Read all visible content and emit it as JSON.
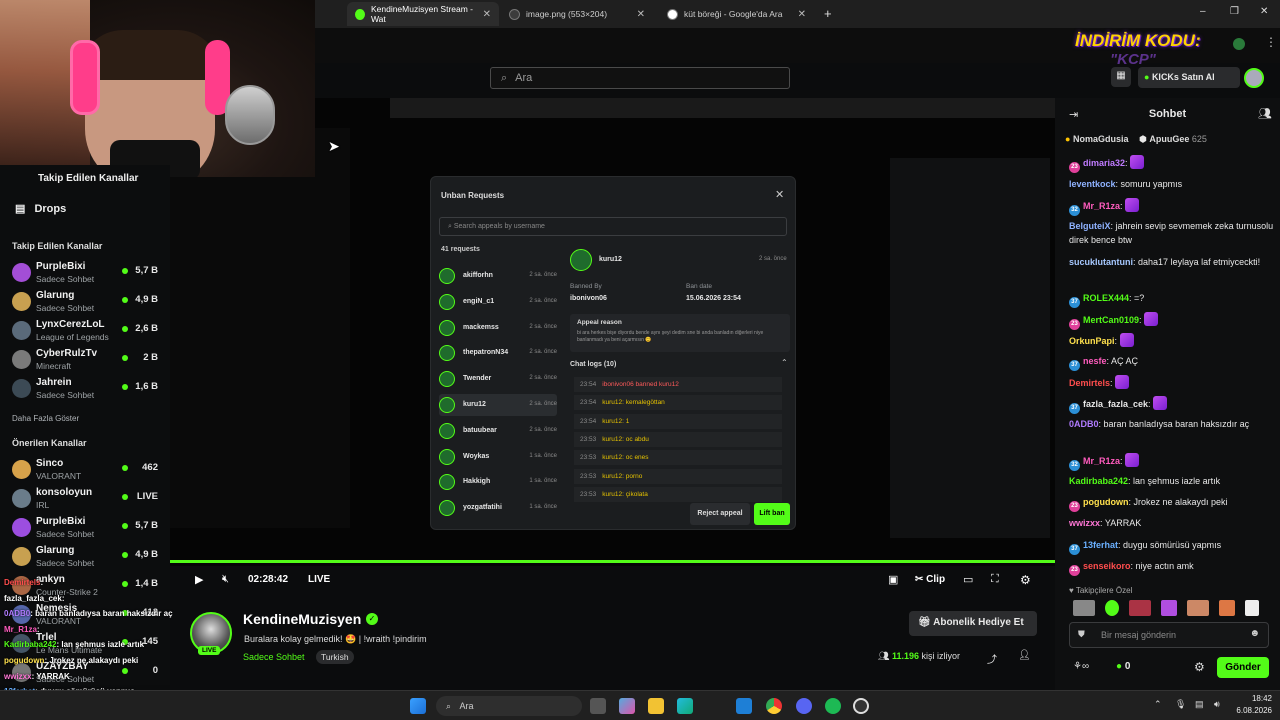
{
  "browser": {
    "tabs": [
      {
        "title": "KendineMuzisyen Stream - Wat",
        "active": true
      },
      {
        "title": "image.png (553×204)",
        "active": false
      },
      {
        "title": "küt böreği - Google'da Ara",
        "active": false
      }
    ],
    "new_tab": "+",
    "window_controls": [
      "–",
      "❐",
      "✕"
    ]
  },
  "header": {
    "search_placeholder": "Ara",
    "promo": "İNDİRİM KODU:",
    "promo_code": "\"KCP\"",
    "buy_kicks": "KICKs Satın Al"
  },
  "sidebar": {
    "top_cut": "Takip Edilen Kanallar",
    "drops": "Drops",
    "followed_title": "Takip Edilen Kanallar",
    "followed": [
      {
        "name": "PurpleBixi",
        "category": "Sadece Sohbet",
        "viewers": "5,7 B"
      },
      {
        "name": "Glarung",
        "category": "Sadece Sohbet",
        "viewers": "4,9 B"
      },
      {
        "name": "LynxCerezLoL",
        "category": "League of Legends",
        "viewers": "2,6 B"
      },
      {
        "name": "CyberRulzTv",
        "category": "Minecraft",
        "viewers": "2 B"
      },
      {
        "name": "Jahrein",
        "category": "Sadece Sohbet",
        "viewers": "1,6 B"
      }
    ],
    "show_more": "Daha Fazla Göster",
    "recommended_title": "Önerilen Kanallar",
    "recommended": [
      {
        "name": "Sinco",
        "category": "VALORANT",
        "viewers": "462"
      },
      {
        "name": "konsoloyun",
        "category": "IRL",
        "viewers": "LIVE"
      },
      {
        "name": "PurpleBixi",
        "category": "Sadece Sohbet",
        "viewers": "5,7 B"
      },
      {
        "name": "Glarung",
        "category": "Sadece Sohbet",
        "viewers": "4,9 B"
      },
      {
        "name": "ankyn",
        "category": "Counter-Strike 2",
        "viewers": "1,4 B"
      },
      {
        "name": "Nemesis",
        "category": "VALORANT",
        "viewers": "412"
      },
      {
        "name": "Trlel",
        "category": "Le Mans Ultimate",
        "viewers": "145"
      },
      {
        "name": "UZAYZBAY",
        "category": "Sadece Sohbet",
        "viewers": "0"
      }
    ]
  },
  "stream_overlay_chat": [
    {
      "user": "Demirtels",
      "text": "",
      "color": "#ff4d4d"
    },
    {
      "user": "fazla_fazla_cek",
      "text": "",
      "color": "#ffffff"
    },
    {
      "user": "0ADB0",
      "text": "baran banladıysa baran haksızdır aç",
      "color": "#b07bff"
    },
    {
      "user": "Mr_R1za",
      "text": "",
      "color": "#ff5cbe"
    },
    {
      "user": "Kadirbaba242",
      "text": "lan şehmus iazle artık",
      "color": "#53fc18"
    },
    {
      "user": "pogudown",
      "text": "Jrokez ne alakaydı peki",
      "color": "#ffe14d"
    },
    {
      "user": "wwizxx",
      "text": "YARRAK",
      "color": "#ff77d6"
    },
    {
      "user": "13ferhat",
      "text": "duygu sömürüsü yapmıs",
      "color": "#6ab0ff"
    },
    {
      "user": "senseikoro",
      "text": "niye actın amk",
      "color": "#ff4d4d"
    }
  ],
  "modal": {
    "title": "Unban Requests",
    "search_placeholder": "Search appeals by username",
    "count": "41 requests",
    "list": [
      {
        "name": "akifforhn",
        "time": "2 sa. önce"
      },
      {
        "name": "engiN_c1",
        "time": "2 sa. önce"
      },
      {
        "name": "mackemss",
        "time": "2 sa. önce"
      },
      {
        "name": "thepatronN34",
        "time": "2 sa. önce"
      },
      {
        "name": "Twender",
        "time": "2 sa. önce"
      },
      {
        "name": "kuru12",
        "time": "2 sa. önce"
      },
      {
        "name": "batuubear",
        "time": "2 sa. önce"
      },
      {
        "name": "Woykas",
        "time": "1 sa. önce"
      },
      {
        "name": "Hakkigh",
        "time": "1 sa. önce"
      },
      {
        "name": "yozgatfatihi",
        "time": "1 sa. önce"
      }
    ],
    "selected_user": "kuru12",
    "selected_time": "2 sa. önce",
    "banned_by_label": "Banned By",
    "banned_by": "ibonivon06",
    "ban_date_label": "Ban date",
    "ban_date": "15.06.2026 23:54",
    "appeal_label": "Appeal reason",
    "appeal_text": "bi ara herkes bişe diyordu bende aynı şeyi dedim sne bi anda banladın diğerleri niye banlanmadı ya beni açarmısın 😊",
    "chat_logs_label": "Chat logs (10)",
    "logs": [
      {
        "time": "23:54",
        "text": "ibonivon06 banned kuru12"
      },
      {
        "time": "23:54",
        "text": "kuru12: kemalegöttan"
      },
      {
        "time": "23:54",
        "text": "kuru12: 1"
      },
      {
        "time": "23:53",
        "text": "kuru12: oc abdu"
      },
      {
        "time": "23:53",
        "text": "kuru12: oc enes"
      },
      {
        "time": "23:53",
        "text": "kuru12: porno"
      },
      {
        "time": "23:53",
        "text": "kuru12: çikolata"
      }
    ],
    "reject": "Reject appeal",
    "lift": "Lift ban"
  },
  "player": {
    "time": "02:28:42",
    "live": "LIVE",
    "clip": "Clip"
  },
  "channel": {
    "name": "KendineMuzisyen",
    "title": "Buralara kolay gelmedik! 🤩 | !wraith !pindirim",
    "category": "Sadece Sohbet",
    "language": "Turkish",
    "live": "LIVE",
    "sub_gift": "Abonelik Hediye Et",
    "viewers": "11.196",
    "viewers_label": "kişi izliyor"
  },
  "chat": {
    "title": "Sohbet",
    "top_gifters": [
      {
        "name": "NomaGdusia",
        "count": ""
      },
      {
        "name": "ApuuGee",
        "count": "625"
      }
    ],
    "messages": [
      {
        "badge": "23",
        "badge_color": "#e0409a",
        "user": "dimaria32",
        "color": "#c07bff",
        "text": "",
        "emote": true
      },
      {
        "badge": "",
        "user": "leventkock",
        "color": "#8fb2ff",
        "text": "somuru yapmıs",
        "emote": false
      },
      {
        "badge": "32",
        "badge_color": "#2b8fd6",
        "user": "Mr_R1za",
        "color": "#ff5cbe",
        "text": "",
        "emote": true
      },
      {
        "badge": "",
        "user": "BelguteiX",
        "color": "#8fb2ff",
        "text": "jahrein sevip sevmemek zeka turnusolu direk bence btw",
        "emote": false
      },
      {
        "badge": "",
        "user": "sucukIutantuni",
        "color": "#a6c8ff",
        "text": "daha17 leylaya laf etmiyceckti!",
        "emote": false
      },
      {
        "badge": "37",
        "badge_color": "#2b8fd6",
        "user": "ROLEX444",
        "color": "#53fc18",
        "text": "=?",
        "emote": false
      },
      {
        "badge": "23",
        "badge_color": "#e0409a",
        "user": "MertCan0109",
        "color": "#53fc18",
        "text": "",
        "emote": true
      },
      {
        "badge": "",
        "user": "OrkunPapi",
        "color": "#ffe14d",
        "text": "",
        "emote": true
      },
      {
        "badge": "37",
        "badge_color": "#2b8fd6",
        "user": "nesfe",
        "color": "#ff5cbe",
        "text": "AÇ AÇ",
        "emote": false
      },
      {
        "badge": "",
        "user": "Demirtels",
        "color": "#ff4d4d",
        "text": "",
        "emote": true
      },
      {
        "badge": "37",
        "badge_color": "#2b8fd6",
        "user": "fazla_fazla_cek",
        "color": "#e8e8e8",
        "text": "",
        "emote": true
      },
      {
        "badge": "",
        "user": "0ADB0",
        "color": "#b07bff",
        "text": "baran banladıysa baran haksızdır aç",
        "emote": false
      },
      {
        "badge": "32",
        "badge_color": "#2b8fd6",
        "user": "Mr_R1za",
        "color": "#ff5cbe",
        "text": "",
        "emote": true
      },
      {
        "badge": "",
        "user": "Kadirbaba242",
        "color": "#53fc18",
        "text": "lan şehmus iazle artık",
        "emote": false
      },
      {
        "badge": "23",
        "badge_color": "#e0409a",
        "user": "pogudown",
        "color": "#ffe14d",
        "text": "Jrokez ne alakaydı peki",
        "emote": false
      },
      {
        "badge": "",
        "user": "wwizxx",
        "color": "#ff77d6",
        "text": "YARRAK",
        "emote": false
      },
      {
        "badge": "37",
        "badge_color": "#2b8fd6",
        "user": "13ferhat",
        "color": "#6ab0ff",
        "text": "duygu sömürüsü yapmıs",
        "emote": false
      },
      {
        "badge": "23",
        "badge_color": "#e0409a",
        "user": "senseikoro",
        "color": "#ff4d4d",
        "text": "niye actın amk",
        "emote": false
      }
    ],
    "emote_label": "Takipçilere Özel",
    "input_placeholder": "Bir mesaj gönderin",
    "points": "0",
    "send": "Gönder"
  },
  "taskbar": {
    "search": "Ara",
    "time": "18:42",
    "date": "6.08.2026"
  },
  "colors": {
    "accent": "#53fc18"
  }
}
